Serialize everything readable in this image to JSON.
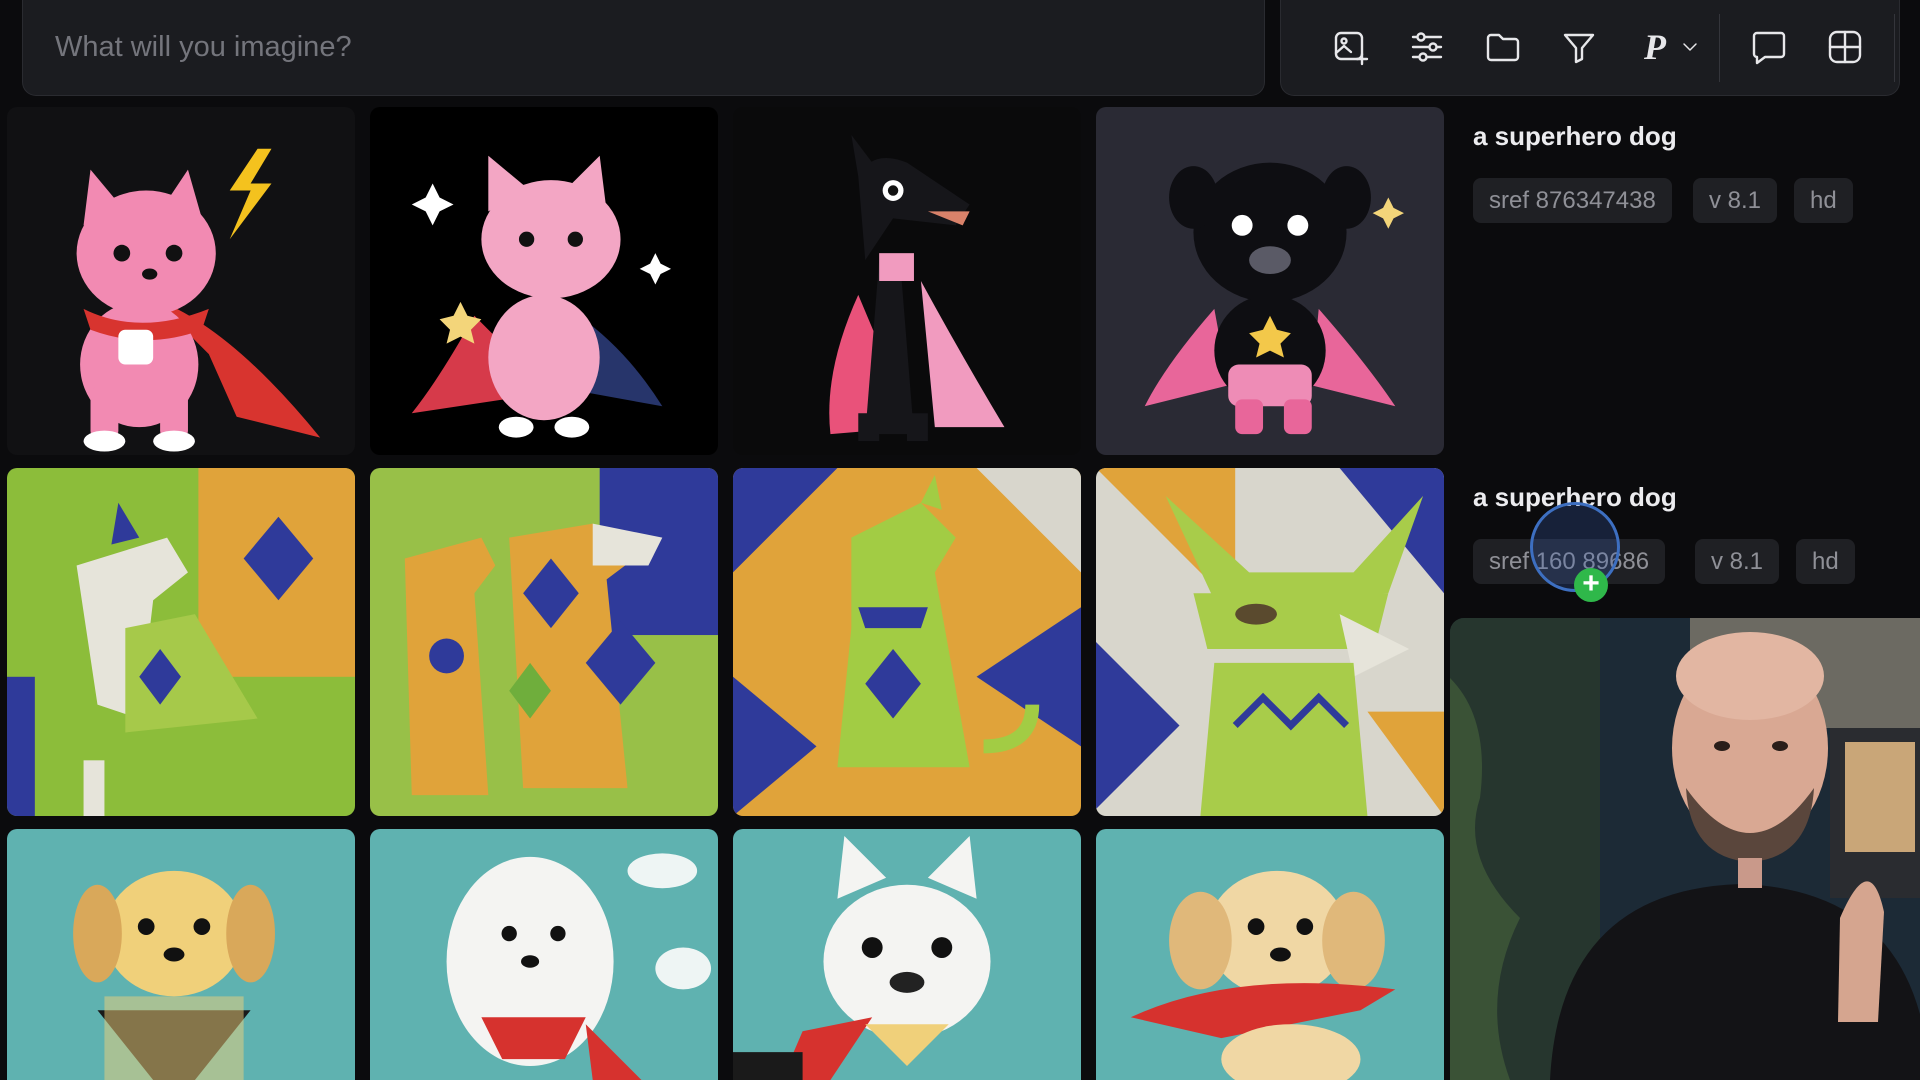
{
  "search": {
    "placeholder": "What will you imagine?"
  },
  "toolbar": {
    "icons": [
      "image-add-icon",
      "sliders-icon",
      "folder-icon",
      "filter-icon",
      "personalize-p-icon",
      "chevron-down-icon",
      "chat-icon",
      "grid-icon"
    ],
    "personalize_label": "P"
  },
  "jobs": [
    {
      "prompt": "a superhero dog",
      "tags": [
        "sref 876347438",
        "v 8.1",
        "hd"
      ],
      "style": "pink cartoon superhero dogs"
    },
    {
      "prompt": "a superhero dog",
      "tags": [
        "sref 160 89686",
        "v 8.1",
        "hd"
      ],
      "style": "geometric cubist dogs in blue, yellow and green"
    },
    {
      "style": "teal comic-ink dogs with red capes"
    }
  ],
  "colors": {
    "background": "#0b0b0d",
    "panel": "#1b1c20",
    "tag_bg": "#1f2024",
    "tag_text": "#8f9097",
    "cursor_plus": "#2fb84a"
  }
}
